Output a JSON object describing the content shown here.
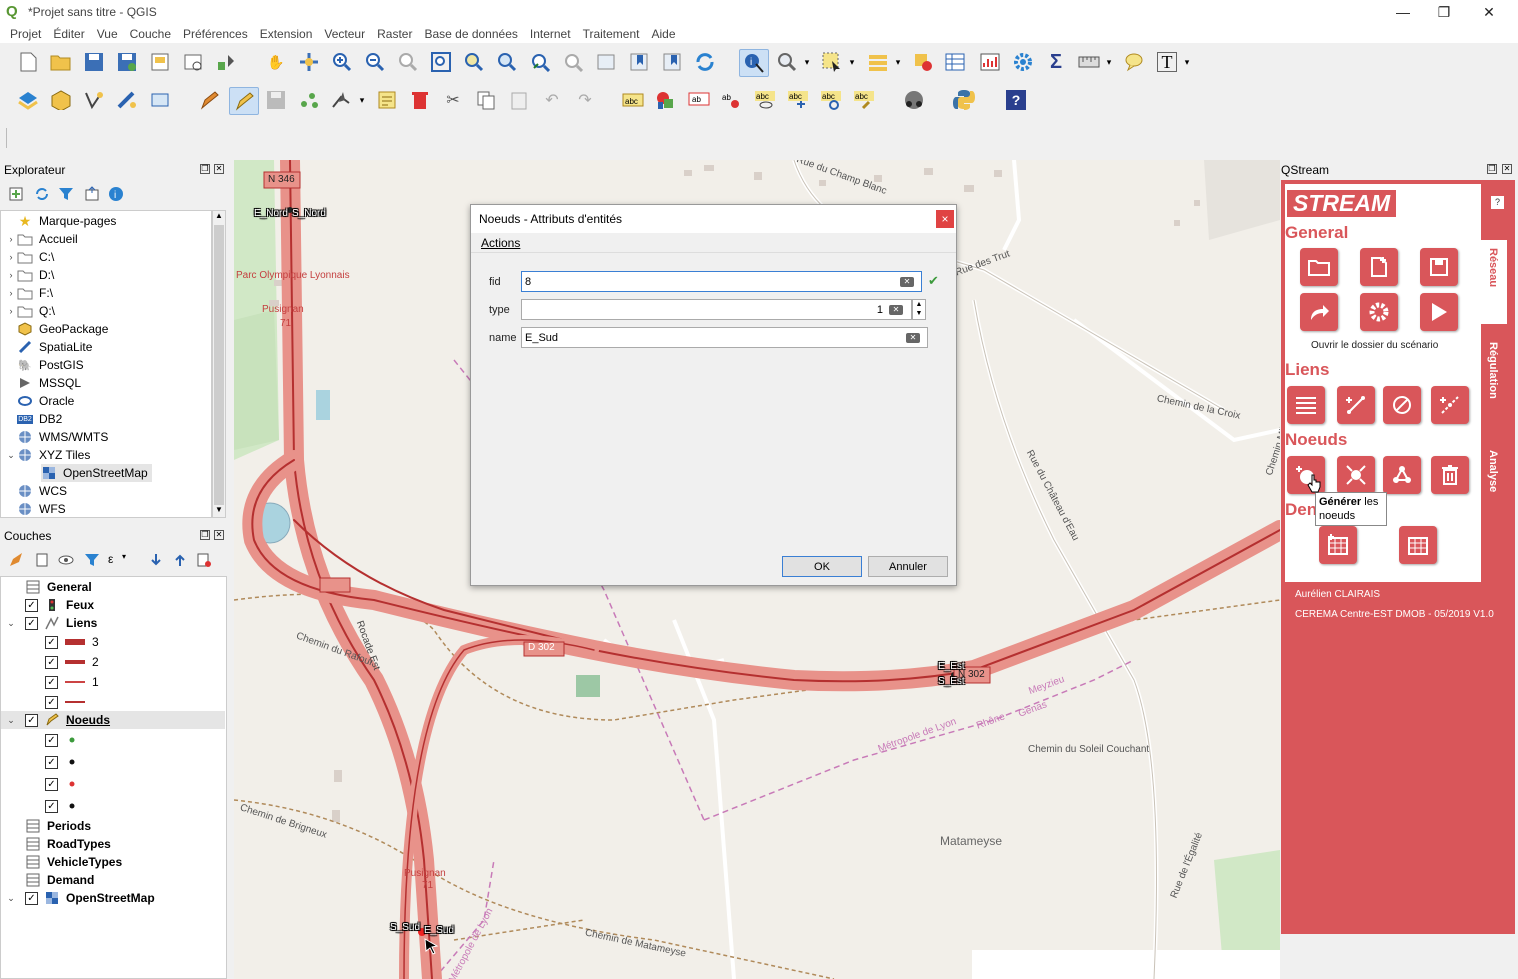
{
  "window": {
    "title": "*Projet sans titre - QGIS",
    "minimize": "—",
    "maximize": "❐",
    "close": "✕"
  },
  "menu": [
    "Projet",
    "Éditer",
    "Vue",
    "Couche",
    "Préférences",
    "Extension",
    "Vecteur",
    "Raster",
    "Base de données",
    "Internet",
    "Traitement",
    "Aide"
  ],
  "browser": {
    "title": "Explorateur",
    "items": [
      {
        "label": "Marque-pages",
        "icon": "star-icon",
        "arrow": ""
      },
      {
        "label": "Accueil",
        "icon": "folder-icon",
        "arrow": "›"
      },
      {
        "label": "C:\\",
        "icon": "folder-icon",
        "arrow": "›"
      },
      {
        "label": "D:\\",
        "icon": "folder-icon",
        "arrow": "›"
      },
      {
        "label": "F:\\",
        "icon": "folder-icon",
        "arrow": "›"
      },
      {
        "label": "Q:\\",
        "icon": "folder-icon",
        "arrow": "›"
      },
      {
        "label": "GeoPackage",
        "icon": "geopackage-icon",
        "arrow": ""
      },
      {
        "label": "SpatiaLite",
        "icon": "spatialite-icon",
        "arrow": ""
      },
      {
        "label": "PostGIS",
        "icon": "postgis-icon",
        "arrow": ""
      },
      {
        "label": "MSSQL",
        "icon": "mssql-icon",
        "arrow": ""
      },
      {
        "label": "Oracle",
        "icon": "oracle-icon",
        "arrow": ""
      },
      {
        "label": "DB2",
        "icon": "db2-icon",
        "arrow": ""
      },
      {
        "label": "WMS/WMTS",
        "icon": "globe-icon",
        "arrow": ""
      },
      {
        "label": "XYZ Tiles",
        "icon": "globe-icon",
        "arrow": "⌄"
      },
      {
        "label": "OpenStreetMap",
        "icon": "tiles-icon",
        "arrow": ""
      },
      {
        "label": "WCS",
        "icon": "globe-icon",
        "arrow": ""
      },
      {
        "label": "WFS",
        "icon": "globe-icon",
        "arrow": ""
      }
    ]
  },
  "layers": {
    "title": "Couches",
    "items": [
      {
        "label": "General",
        "bold": true,
        "checked": false,
        "icon": "table-icon"
      },
      {
        "label": "Feux",
        "bold": true,
        "checked": true,
        "icon": "traffic-light-icon"
      },
      {
        "label": "Liens",
        "bold": true,
        "checked": true,
        "icon": "line-layer-icon"
      },
      {
        "label": "3",
        "bold": false,
        "checked": true,
        "icon": "line-style-thick-icon"
      },
      {
        "label": "2",
        "bold": false,
        "checked": true,
        "icon": "line-style-medium-icon"
      },
      {
        "label": "1",
        "bold": false,
        "checked": true,
        "icon": "line-style-thin-icon"
      },
      {
        "label": "",
        "bold": false,
        "checked": true,
        "icon": "line-style-empty-icon"
      },
      {
        "label": "Noeuds",
        "bold": true,
        "checked": true,
        "icon": "edit-layer-icon"
      },
      {
        "label": "",
        "bold": false,
        "checked": true,
        "icon": "point-green-icon"
      },
      {
        "label": "",
        "bold": false,
        "checked": true,
        "icon": "point-black-icon"
      },
      {
        "label": "",
        "bold": false,
        "checked": true,
        "icon": "point-red-icon"
      },
      {
        "label": "",
        "bold": false,
        "checked": true,
        "icon": "point-black-icon"
      },
      {
        "label": "Periods",
        "bold": true,
        "checked": false,
        "icon": "table-icon"
      },
      {
        "label": "RoadTypes",
        "bold": true,
        "checked": false,
        "icon": "table-icon"
      },
      {
        "label": "VehicleTypes",
        "bold": true,
        "checked": false,
        "icon": "table-icon"
      },
      {
        "label": "Demand",
        "bold": true,
        "checked": false,
        "icon": "table-icon"
      },
      {
        "label": "OpenStreetMap",
        "bold": true,
        "checked": true,
        "icon": "tiles-icon"
      }
    ]
  },
  "map": {
    "labels": [
      "N 346",
      "Parc Olympique Lyonnais",
      "Pusignan",
      "71",
      "Rue du Champ Blanc",
      "Rue des Trut",
      "Chemin de la Croix",
      "Rue du Château d'Eau",
      "Chemin Mil",
      "Chemin du Rafour",
      "Rocade Est",
      "D 302",
      "N 302",
      "Métropole de Lyon",
      "Rhône",
      "Genas",
      "Meyzieu",
      "Chemin du Soleil Couchant",
      "Chemin de Brigneux",
      "Matameyse",
      "Rue de l'Égalité",
      "Chemin de Matameyse",
      "Métropole de Lyon",
      "Pusignan",
      "71"
    ],
    "nodes": [
      "E_Nord",
      "S_Nord",
      "E_Est",
      "S_Est",
      "S_Sud",
      "E_Sud"
    ],
    "road_color": "#e8928a",
    "road_edge": "#b53030"
  },
  "dialog": {
    "title": "Noeuds - Attributs d'entités",
    "close": "×",
    "menu": "Actions",
    "fields": [
      {
        "label": "fid",
        "value": "8"
      },
      {
        "label": "type",
        "value": "1"
      },
      {
        "label": "name",
        "value": "E_Sud"
      }
    ],
    "ok": "OK",
    "cancel": "Annuler",
    "valid_mark": "✔"
  },
  "qstream": {
    "panel_title": "QStream",
    "logo": "STREAM",
    "help": "?",
    "sections": {
      "general": "General",
      "liens": "Liens",
      "noeuds": "Noeuds",
      "demande": "Den"
    },
    "general_buttons": [
      "folder-open-icon",
      "new-file-icon",
      "save-icon",
      "export-icon",
      "settings-icon",
      "run-icon"
    ],
    "general_caption": "Ouvrir le dossier du scénario",
    "liens_buttons": [
      "list-icon",
      "add-link-icon",
      "reverse-link-icon",
      "split-link-icon"
    ],
    "noeuds_buttons": [
      "generate-nodes-icon",
      "node-connect-icon",
      "node-merge-icon",
      "delete-nodes-icon"
    ],
    "demand_buttons": [
      "table-add-icon",
      "table-icon"
    ],
    "tooltip": {
      "bold": "Générer",
      "rest": " les noeuds"
    },
    "tabs": [
      "Réseau",
      "Régulation",
      "Analyse"
    ],
    "author": "Aurélien CLAIRAIS",
    "org": "CEREMA Centre-EST DMOB - 05/2019 V1.0",
    "accent": "#d9565a"
  }
}
